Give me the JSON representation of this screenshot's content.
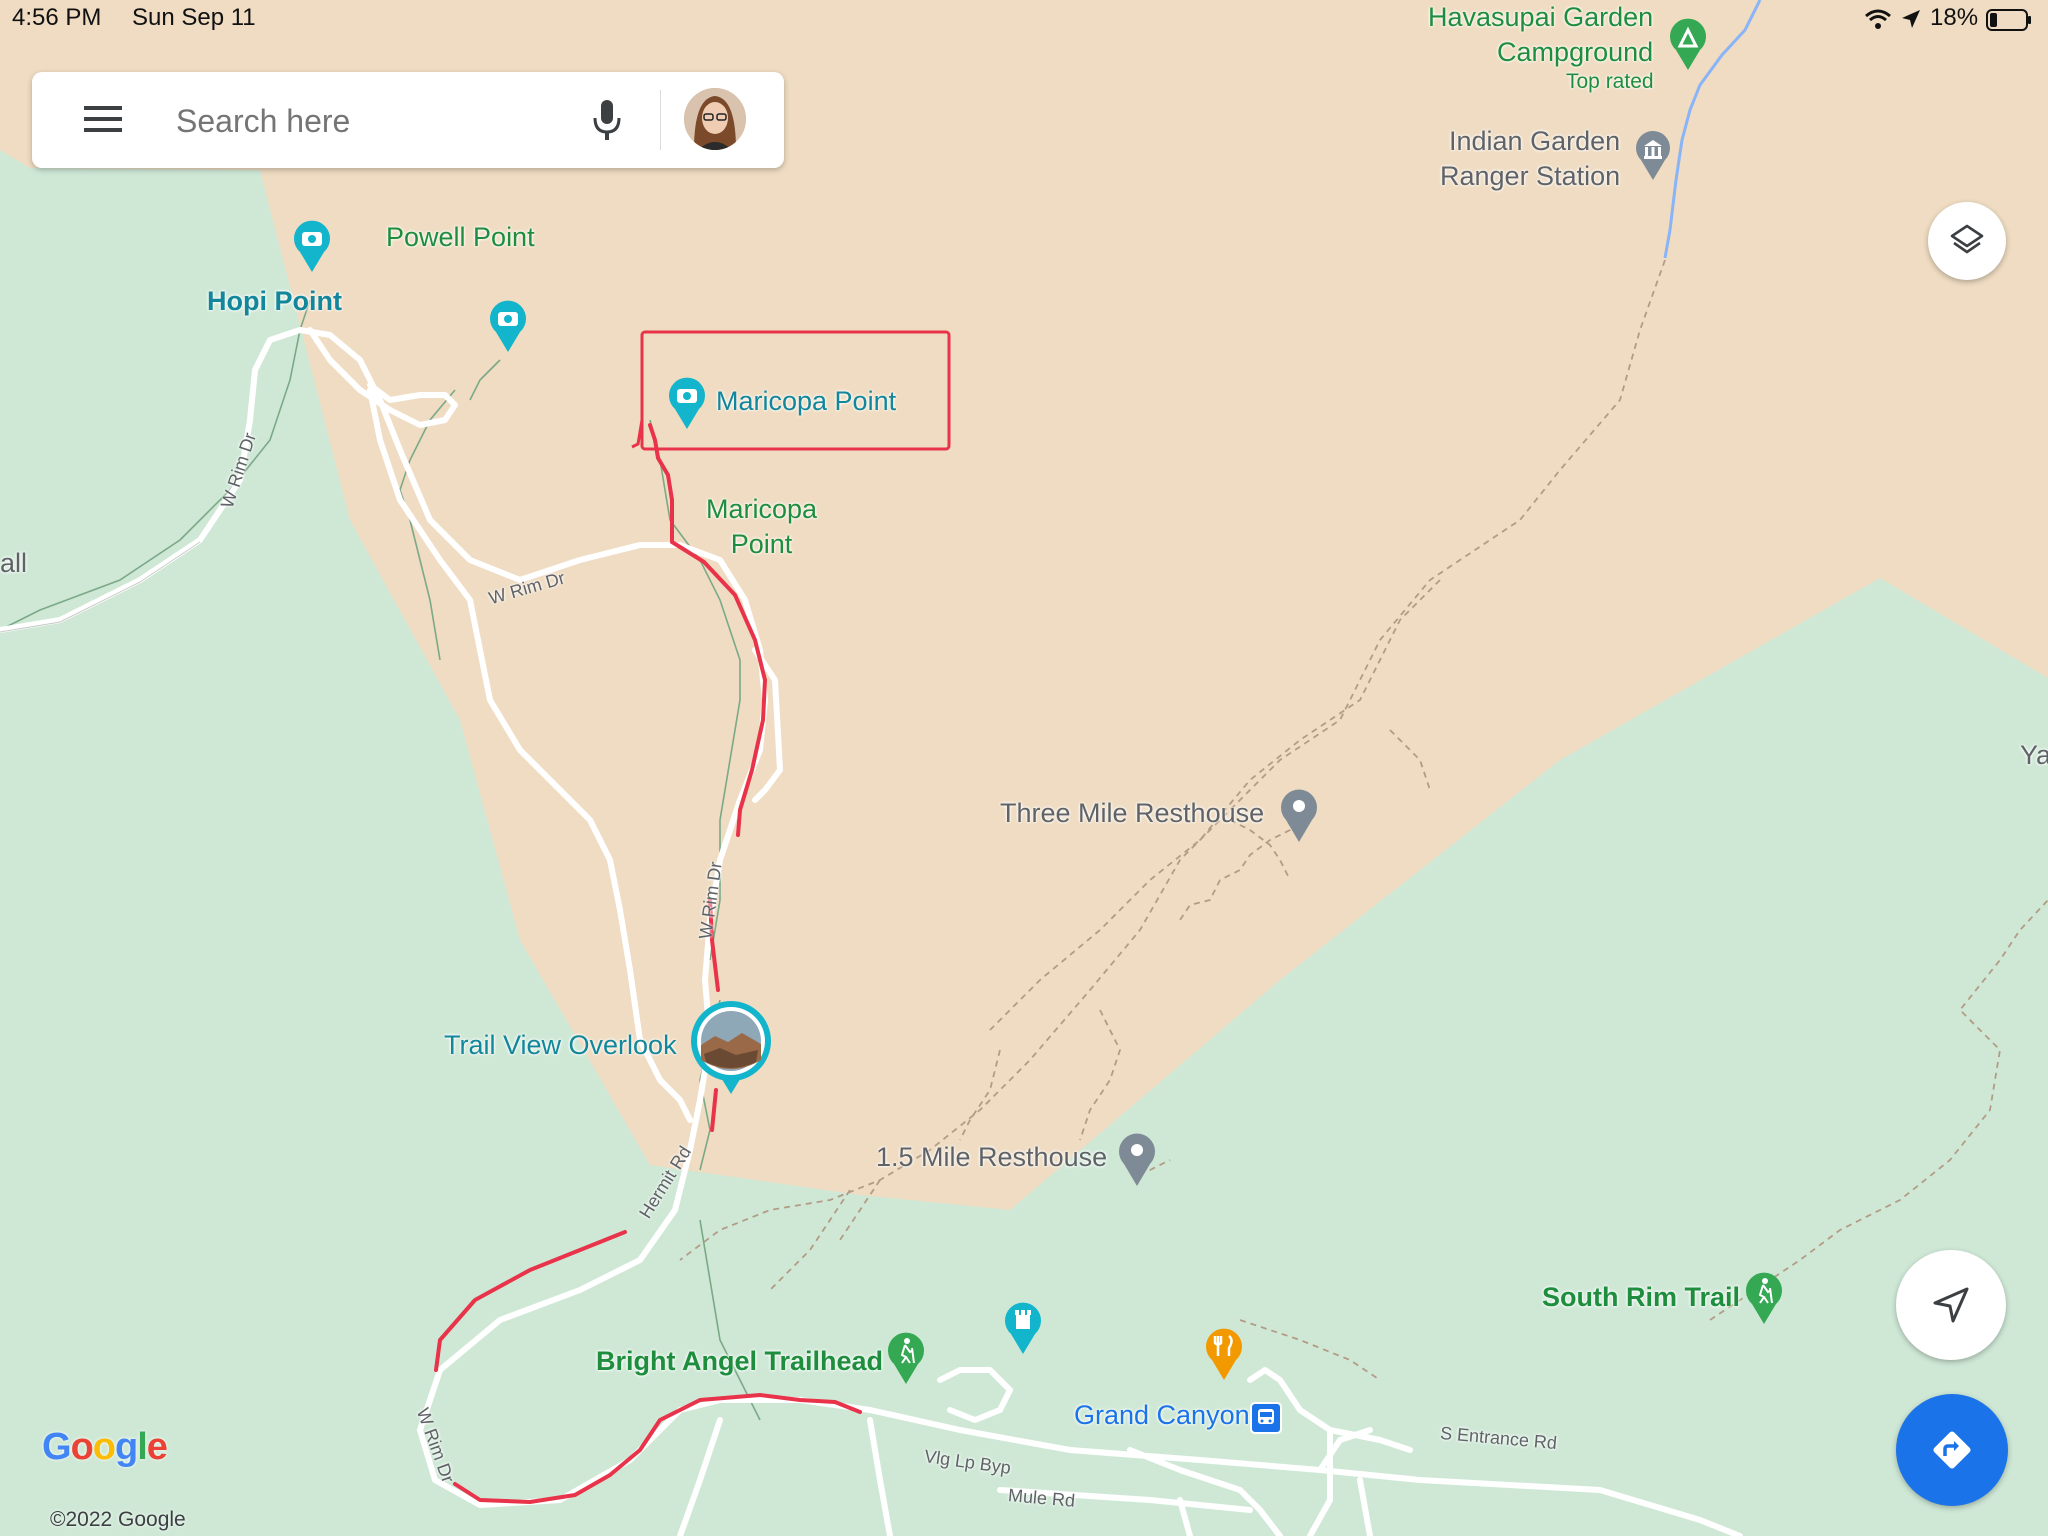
{
  "status_bar": {
    "time": "4:56 PM",
    "date": "Sun Sep 11",
    "battery": "18%"
  },
  "search": {
    "placeholder": "Search here",
    "icons": [
      "menu-icon",
      "microphone-icon",
      "avatar"
    ]
  },
  "places": {
    "havasupai": "Havasupai Garden\nCampground",
    "havasupai_tag": "Top rated",
    "indian_garden": "Indian Garden\nRanger Station",
    "powell_point": "Powell Point",
    "hopi_point": "Hopi Point",
    "maricopa_point_poi": "Maricopa Point",
    "maricopa_point_area": "Maricopa\nPoint",
    "three_mile": "Three Mile Resthouse",
    "trail_view": "Trail View Overlook",
    "one_half_mile": "1.5 Mile Resthouse",
    "south_rim_trail": "South Rim Trail",
    "bright_angel": "Bright Angel Trailhead",
    "grand_canyon": "Grand Canyon",
    "edge_left": "all",
    "edge_right": "Ya"
  },
  "roads": {
    "w_rim_dr_1": "W Rim Dr",
    "w_rim_dr_2": "W Rim Dr",
    "w_rim_dr_3": "W Rim Dr",
    "w_rim_dr_4": "W Rim Dr",
    "hermit_rd": "Hermit Rd",
    "vlg_lp_byp": "Vlg Lp Byp",
    "mule_rd": "Mule Rd",
    "s_entrance_rd": "S Entrance Rd"
  },
  "branding": {
    "logo": "Google",
    "copyright": "©2022 Google"
  },
  "controls": {
    "layers": "layers-icon",
    "locate": "navigation-arrow-icon",
    "directions": "directions-icon"
  },
  "colors": {
    "canyon": "#efdcc2",
    "park": "#cfe8d6",
    "annotation": "#e8334a",
    "teal": "#12869a",
    "green": "#1e8e3e",
    "directions_blue": "#1a73e8"
  }
}
